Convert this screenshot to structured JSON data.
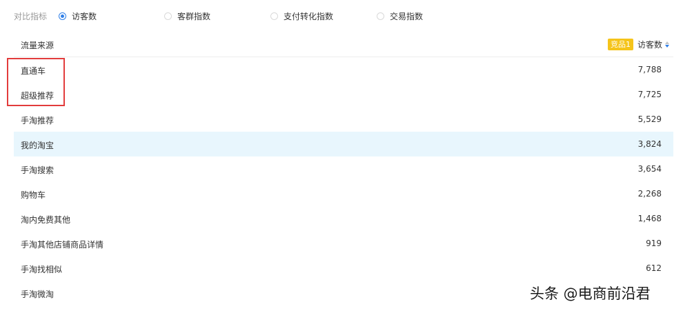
{
  "compare": {
    "label": "对比指标",
    "options": [
      {
        "label": "访客数",
        "checked": true
      },
      {
        "label": "客群指数",
        "checked": false
      },
      {
        "label": "支付转化指数",
        "checked": false
      },
      {
        "label": "交易指数",
        "checked": false
      }
    ]
  },
  "table": {
    "header": {
      "source": "流量来源",
      "badge": "竞品1",
      "visitors": "访客数",
      "sort_icon": "sort-descending-icon"
    },
    "rows": [
      {
        "source": "直通车",
        "visitors": "7,788"
      },
      {
        "source": "超级推荐",
        "visitors": "7,725"
      },
      {
        "source": "手淘推荐",
        "visitors": "5,529"
      },
      {
        "source": "我的淘宝",
        "visitors": "3,824",
        "hovered": true
      },
      {
        "source": "手淘搜索",
        "visitors": "3,654"
      },
      {
        "source": "购物车",
        "visitors": "2,268"
      },
      {
        "source": "淘内免费其他",
        "visitors": "1,468"
      },
      {
        "source": "手淘其他店铺商品详情",
        "visitors": "919"
      },
      {
        "source": "手淘找相似",
        "visitors": "612"
      },
      {
        "source": "手淘微淘",
        "visitors": ""
      }
    ]
  },
  "watermark": "头条 @电商前沿君",
  "colors": {
    "accent": "#2f7fe8",
    "badge": "#f5c41a",
    "hover_row": "#e8f6fd",
    "highlight": "#e23b3b"
  }
}
